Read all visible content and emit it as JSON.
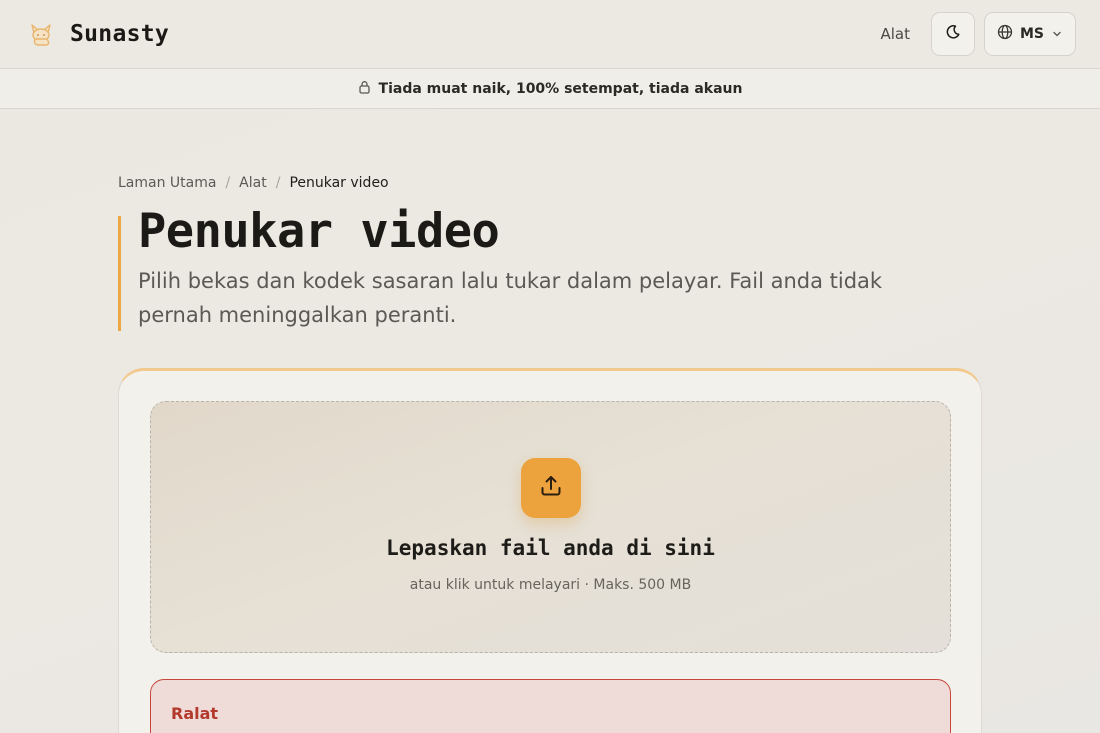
{
  "header": {
    "brand": "Sunasty",
    "nav_tools": "Alat",
    "language": "MS"
  },
  "banner": {
    "text": "Tiada muat naik, 100% setempat, tiada akaun"
  },
  "breadcrumb": {
    "home": "Laman Utama",
    "separator": "/",
    "tools": "Alat",
    "current": "Penukar video"
  },
  "hero": {
    "title": "Penukar video",
    "subtitle": "Pilih bekas dan kodek sasaran lalu tukar dalam pelayar. Fail anda tidak pernah meninggalkan peranti."
  },
  "dropzone": {
    "title": "Lepaskan fail anda di sini",
    "hint": "atau klik untuk melayari · Maks. 500 MB"
  },
  "error": {
    "title": "Ralat"
  },
  "colors": {
    "accent": "#eda33d",
    "error": "#b3392d"
  },
  "icons": {
    "logo": "cat-logo-icon",
    "theme": "moon-icon",
    "language": "globe-icon",
    "chevron": "chevron-down-icon",
    "banner": "lock-icon",
    "upload": "upload-icon"
  }
}
